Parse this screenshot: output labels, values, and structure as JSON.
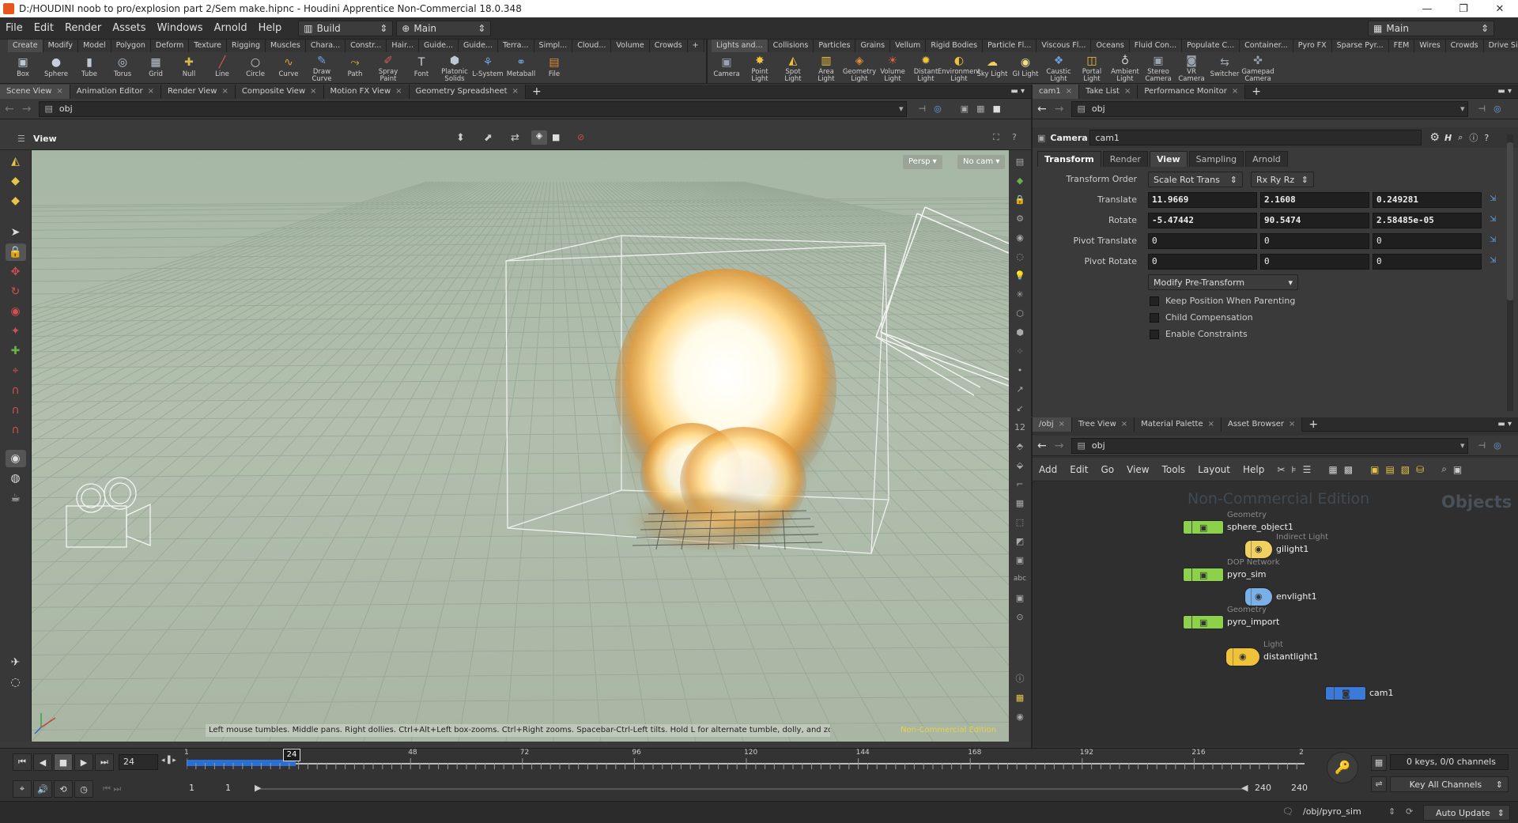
{
  "window": {
    "title": "D:/HOUDINI noob to pro/explosion part 2/Sem make.hipnc - Houdini Apprentice Non-Commercial 18.0.348",
    "controls": [
      "—",
      "❐",
      "✕"
    ]
  },
  "menubar": {
    "items": [
      "File",
      "Edit",
      "Render",
      "Assets",
      "Windows",
      "Arnold",
      "Help"
    ],
    "desktop": "Build",
    "context": "Main",
    "right_context": "Main"
  },
  "shelf_left": {
    "tabs": [
      "Create",
      "Modify",
      "Model",
      "Polygon",
      "Deform",
      "Texture",
      "Rigging",
      "Muscles",
      "Chara...",
      "Constr...",
      "Hair...",
      "Guide...",
      "Guide...",
      "Terra...",
      "Simpl...",
      "Cloud...",
      "Volume",
      "Crowds",
      "+"
    ],
    "tools": [
      {
        "label": "Box",
        "icon": "box-icon",
        "glyph": "▣",
        "color": "#bfc7d0"
      },
      {
        "label": "Sphere",
        "icon": "sphere-icon",
        "glyph": "●",
        "color": "#c8cfd8"
      },
      {
        "label": "Tube",
        "icon": "tube-icon",
        "glyph": "▮",
        "color": "#bfc7d0"
      },
      {
        "label": "Torus",
        "icon": "torus-icon",
        "glyph": "◎",
        "color": "#bfc7d0"
      },
      {
        "label": "Grid",
        "icon": "grid-icon",
        "glyph": "▦",
        "color": "#bfc7d0"
      },
      {
        "label": "Null",
        "icon": "null-icon",
        "glyph": "✚",
        "color": "#d9b84a"
      },
      {
        "label": "Line",
        "icon": "line-icon",
        "glyph": "╱",
        "color": "#d85a5a"
      },
      {
        "label": "Circle",
        "icon": "circle-icon",
        "glyph": "○",
        "color": "#c8cfd8"
      },
      {
        "label": "Curve",
        "icon": "curve-icon",
        "glyph": "∿",
        "color": "#d9a04a"
      },
      {
        "label": "Draw Curve",
        "icon": "draw-curve-icon",
        "glyph": "✎",
        "color": "#6aa2e0"
      },
      {
        "label": "Path",
        "icon": "path-icon",
        "glyph": "⤳",
        "color": "#d9b84a"
      },
      {
        "label": "Spray Paint",
        "icon": "spray-paint-icon",
        "glyph": "✐",
        "color": "#d85a5a"
      },
      {
        "label": "Font",
        "icon": "font-icon",
        "glyph": "T",
        "color": "#c8cfd8"
      },
      {
        "label": "Platonic Solids",
        "icon": "platonic-solids-icon",
        "glyph": "⬢",
        "color": "#bfc7d0"
      },
      {
        "label": "L-System",
        "icon": "l-system-icon",
        "glyph": "⚘",
        "color": "#6aa2e0"
      },
      {
        "label": "Metaball",
        "icon": "metaball-icon",
        "glyph": "⚭",
        "color": "#6aa2e0"
      },
      {
        "label": "File",
        "icon": "file-icon",
        "glyph": "▤",
        "color": "#e08a3a"
      }
    ]
  },
  "shelf_right": {
    "tabs": [
      "Lights and...",
      "Collisions",
      "Particles",
      "Grains",
      "Vellum",
      "Rigid Bodies",
      "Particle Fl...",
      "Viscous Fl...",
      "Oceans",
      "Fluid Con...",
      "Populate C...",
      "Container...",
      "Pyro FX",
      "Sparse Pyr...",
      "FEM",
      "Wires",
      "Crowds",
      "Drive Sim...",
      "+"
    ],
    "tools": [
      {
        "label": "Camera",
        "icon": "camera-icon",
        "glyph": "▣",
        "color": "#9aa3ad"
      },
      {
        "label": "Point Light",
        "icon": "point-light-icon",
        "glyph": "✸",
        "color": "#f0c23a"
      },
      {
        "label": "Spot Light",
        "icon": "spot-light-icon",
        "glyph": "◭",
        "color": "#f0c23a"
      },
      {
        "label": "Area Light",
        "icon": "area-light-icon",
        "glyph": "▥",
        "color": "#f0c23a"
      },
      {
        "label": "Geometry Light",
        "icon": "geometry-light-icon",
        "glyph": "◈",
        "color": "#e08a3a"
      },
      {
        "label": "Volume Light",
        "icon": "volume-light-icon",
        "glyph": "☀",
        "color": "#e0603a"
      },
      {
        "label": "Distant Light",
        "icon": "distant-light-icon",
        "glyph": "✹",
        "color": "#f0c23a"
      },
      {
        "label": "Environment Light",
        "icon": "environment-light-icon",
        "glyph": "◐",
        "color": "#f0c23a"
      },
      {
        "label": "Sky Light",
        "icon": "sky-light-icon",
        "glyph": "☁",
        "color": "#f0d060"
      },
      {
        "label": "GI Light",
        "icon": "gi-light-icon",
        "glyph": "◉",
        "color": "#f0e08a"
      },
      {
        "label": "Caustic Light",
        "icon": "caustic-light-icon",
        "glyph": "❖",
        "color": "#6aa2e0"
      },
      {
        "label": "Portal Light",
        "icon": "portal-light-icon",
        "glyph": "◫",
        "color": "#f0c23a"
      },
      {
        "label": "Ambient Light",
        "icon": "ambient-light-icon",
        "glyph": "♁",
        "color": "#d0d0d0"
      },
      {
        "label": "Stereo Camera",
        "icon": "stereo-camera-icon",
        "glyph": "▣",
        "color": "#9aa3ad"
      },
      {
        "label": "VR Camera",
        "icon": "vr-camera-icon",
        "glyph": "◙",
        "color": "#9aa3ad"
      },
      {
        "label": "Switcher",
        "icon": "switcher-icon",
        "glyph": "⇆",
        "color": "#9aa3ad"
      },
      {
        "label": "Gamepad Camera",
        "icon": "gamepad-camera-icon",
        "glyph": "✜",
        "color": "#9aa3ad"
      }
    ]
  },
  "scene_view": {
    "tabs": [
      "Scene View",
      "Animation Editor",
      "Render View",
      "Composite View",
      "Motion FX View",
      "Geometry Spreadsheet"
    ],
    "path": "obj",
    "view_label": "View",
    "persp_button": "Persp ▾",
    "cam_button": "No cam ▾",
    "hint": "Left mouse tumbles. Middle pans. Right dollies. Ctrl+Alt+Left box-zooms. Ctrl+Right zooms. Spacebar-Ctrl-Left tilts. Hold L for alternate tumble, dolly, and zoom.",
    "watermark": "Non-Commercial Edition"
  },
  "param_pane": {
    "tabs": [
      "cam1",
      "Take List",
      "Performance Monitor"
    ],
    "path": "obj",
    "node_type": "Camera",
    "node_name": "cam1",
    "subtabs": [
      "Transform",
      "Render",
      "View",
      "Sampling",
      "Arnold"
    ],
    "transform_order_label": "Transform Order",
    "transform_order": "Scale Rot Trans",
    "rot_order": "Rx Ry Rz",
    "rows": [
      {
        "label": "Translate",
        "values": [
          "11.9669",
          "2.1608",
          "0.249281"
        ]
      },
      {
        "label": "Rotate",
        "values": [
          "-5.47442",
          "90.5474",
          "2.58485e-05"
        ]
      },
      {
        "label": "Pivot Translate",
        "values": [
          "0",
          "0",
          "0"
        ]
      },
      {
        "label": "Pivot Rotate",
        "values": [
          "0",
          "0",
          "0"
        ]
      }
    ],
    "modify_button": "Modify Pre-Transform",
    "checkboxes": [
      "Keep Position When Parenting",
      "Child Compensation",
      "Enable Constraints"
    ]
  },
  "network_pane": {
    "tabs": [
      "/obj",
      "Tree View",
      "Material Palette",
      "Asset Browser"
    ],
    "path": "obj",
    "menu": [
      "Add",
      "Edit",
      "Go",
      "View",
      "Tools",
      "Layout",
      "Help"
    ],
    "watermark": "Non-Commercial Edition",
    "context_label": "Objects",
    "nodes": [
      {
        "type": "Geometry",
        "name": "sphere_object1",
        "color": "#8bd14a"
      },
      {
        "type": "Indirect Light",
        "name": "gilight1",
        "color": "#f0d060"
      },
      {
        "type": "DOP Network",
        "name": "pyro_sim",
        "color": "#8bd14a"
      },
      {
        "type": "",
        "name": "envlight1",
        "color": "#7ab0e8"
      },
      {
        "type": "Geometry",
        "name": "pyro_import",
        "color": "#8bd14a"
      },
      {
        "type": "Light",
        "name": "distantlight1",
        "color": "#f0c23a"
      },
      {
        "type": "",
        "name": "cam1",
        "color": "#3a7ad8"
      }
    ]
  },
  "timeline": {
    "current_frame": "24",
    "ticks": [
      "1",
      "24",
      "48",
      "72",
      "96",
      "120",
      "144",
      "168",
      "192",
      "216",
      "2"
    ],
    "start_field": "1",
    "start_field2": "1",
    "end_field": "240",
    "end_field2": "240",
    "keys_label": "0 keys, 0/0 channels",
    "key_all": "Key All Channels",
    "status_path": "/obj/pyro_sim",
    "update_mode": "Auto Update"
  }
}
